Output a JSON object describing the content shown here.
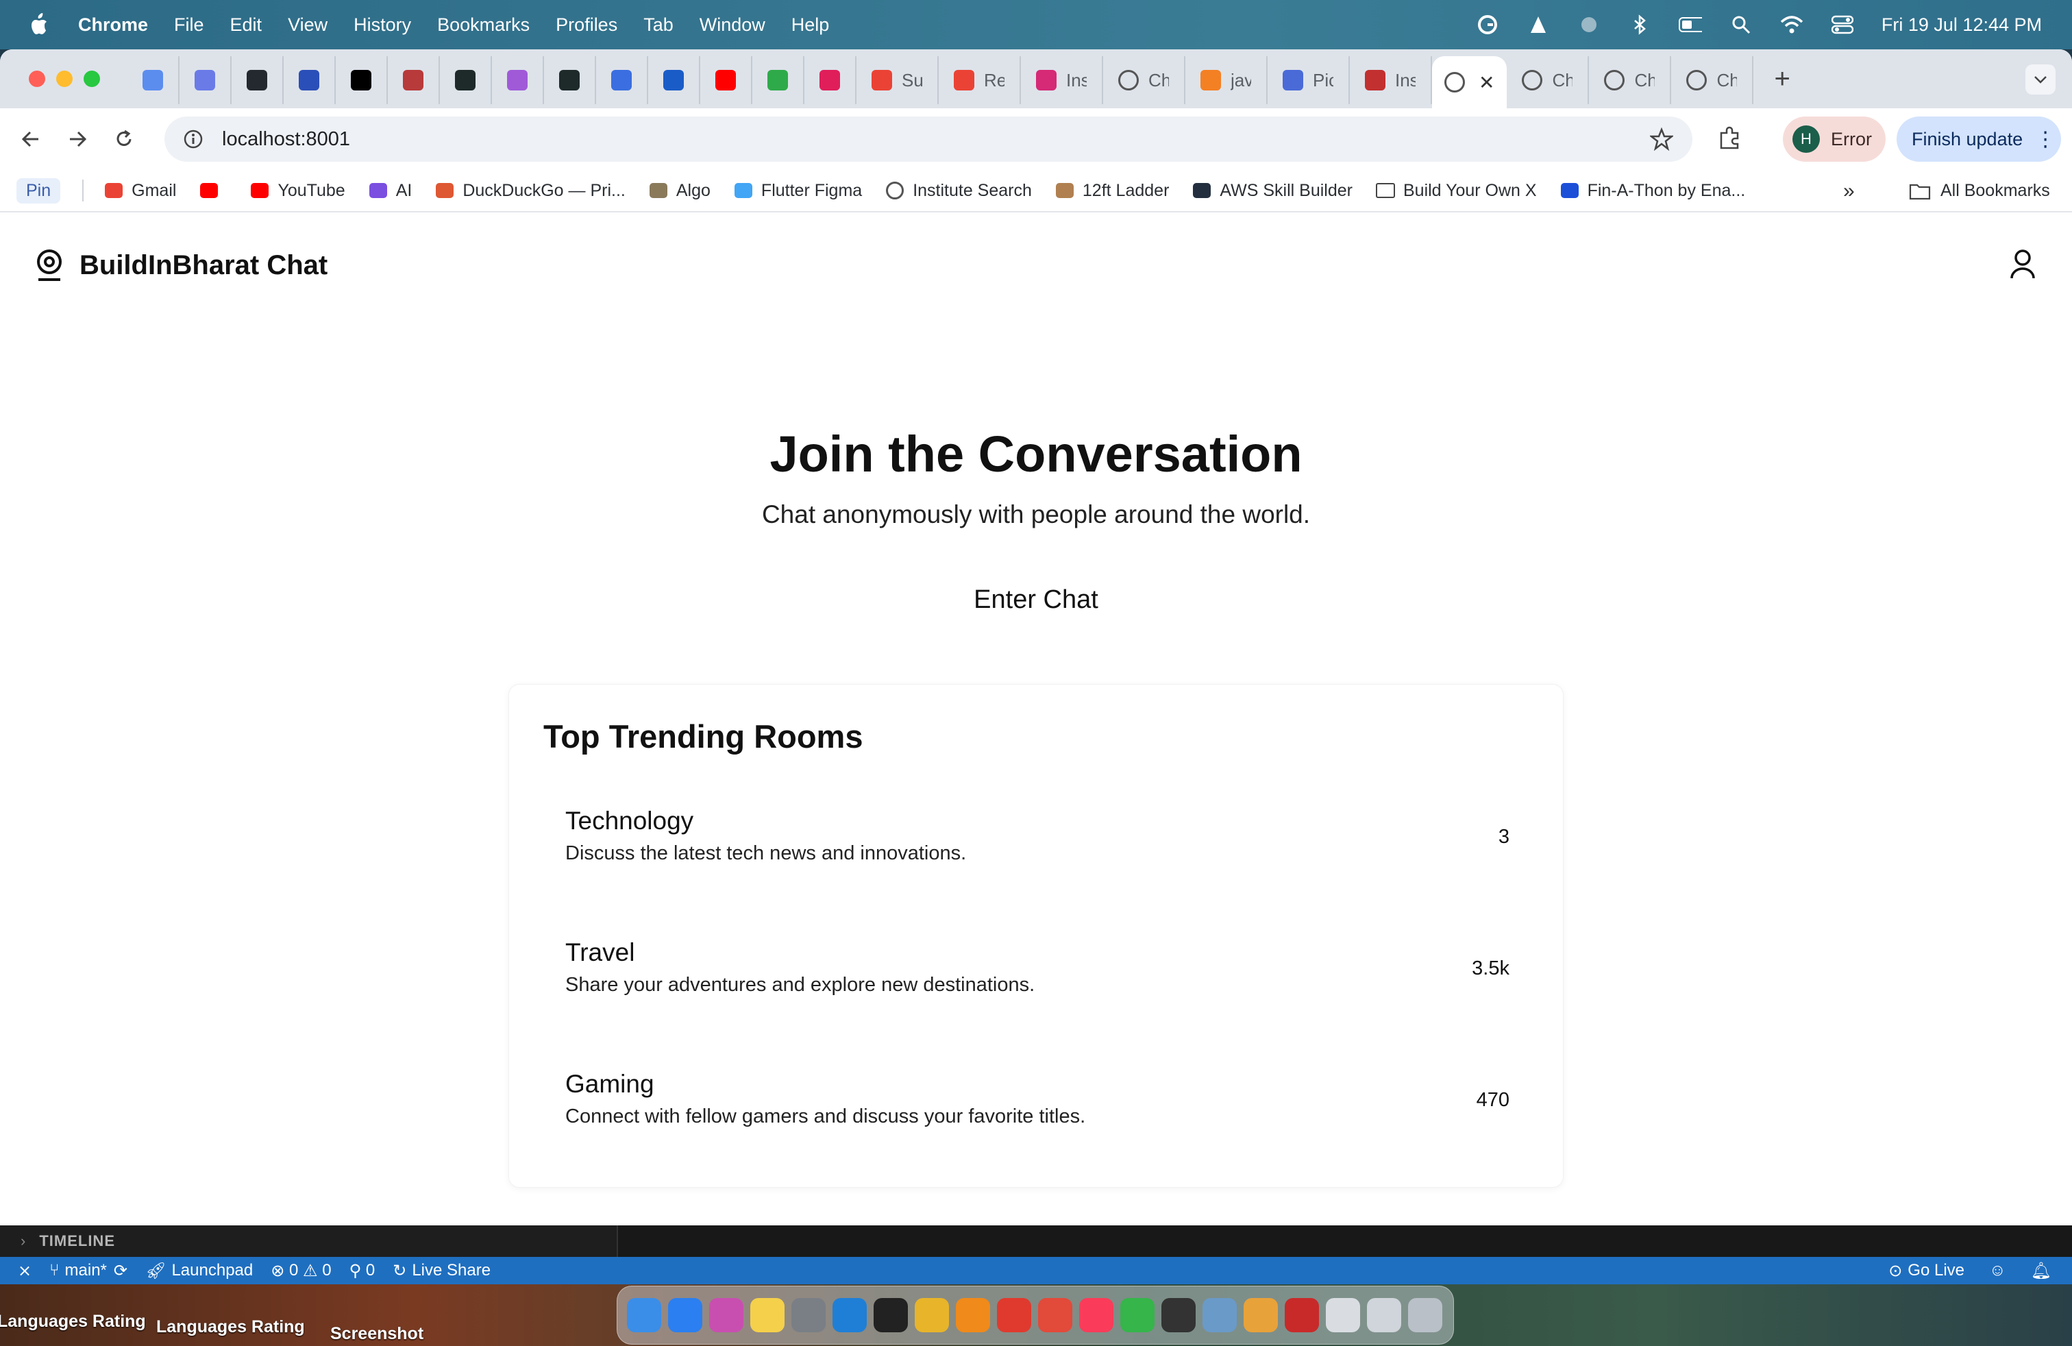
{
  "menubar": {
    "app": "Chrome",
    "items": [
      "File",
      "Edit",
      "View",
      "History",
      "Bookmarks",
      "Profiles",
      "Tab",
      "Window",
      "Help"
    ],
    "datetime": "Fri 19 Jul  12:44 PM"
  },
  "tabs": [
    {
      "title": "",
      "icon": "gemini-icon",
      "color": "#5b8def"
    },
    {
      "title": "",
      "icon": "magnet-icon",
      "color": "#6a7be8"
    },
    {
      "title": "",
      "icon": "github-icon",
      "color": "#24292f"
    },
    {
      "title": "",
      "icon": "half-moon-icon",
      "color": "#2b4fb8"
    },
    {
      "title": "",
      "icon": "medium-icon",
      "color": "#000000"
    },
    {
      "title": "",
      "icon": "bug-icon",
      "color": "#b83a3a"
    },
    {
      "title": "",
      "icon": "gc-icon",
      "color": "#1e2a2a"
    },
    {
      "title": "",
      "icon": "gradient-icon",
      "color": "#a05ad8"
    },
    {
      "title": "",
      "icon": "gc-icon",
      "color": "#1e2a2a"
    },
    {
      "title": "",
      "icon": "translate-icon",
      "color": "#3b6ee0"
    },
    {
      "title": "",
      "icon": "arc-icon",
      "color": "#1a5cc7"
    },
    {
      "title": "",
      "icon": "youtube-icon",
      "color": "#ff0000"
    },
    {
      "title": "",
      "icon": "green-badge-icon",
      "color": "#2faa4a"
    },
    {
      "title": "",
      "icon": "slack-icon",
      "color": "#e01e5a"
    },
    {
      "title": "Su",
      "icon": "gmail-icon",
      "color": "#ea4335"
    },
    {
      "title": "Re",
      "icon": "gmail-icon",
      "color": "#ea4335"
    },
    {
      "title": "Ins",
      "icon": "instagram-icon",
      "color": "#d62976"
    },
    {
      "title": "Ch",
      "icon": "globe-icon",
      "color": "#555555"
    },
    {
      "title": "jav",
      "icon": "stackoverflow-icon",
      "color": "#f48024"
    },
    {
      "title": "Pic",
      "icon": "cloud-icon",
      "color": "#4a6ad8"
    },
    {
      "title": "Ins",
      "icon": "cube-icon",
      "color": "#c23030"
    }
  ],
  "active_tab": {
    "icon": "globe-icon"
  },
  "trailing_tabs": [
    {
      "title": "Ch",
      "icon": "globe-icon"
    },
    {
      "title": "Ch",
      "icon": "globe-icon"
    },
    {
      "title": "Ch",
      "icon": "globe-icon"
    }
  ],
  "toolbar": {
    "url": "localhost:8001",
    "profile_initial": "H",
    "profile_label": "Error",
    "update_label": "Finish update"
  },
  "bookmarks": {
    "pin": "Pin",
    "items": [
      {
        "label": "Gmail",
        "icon": "gmail-icon"
      },
      {
        "label": "",
        "icon": "youtube-icon"
      },
      {
        "label": "YouTube",
        "icon": "youtube-icon"
      },
      {
        "label": "AI",
        "icon": "ai-v-icon"
      },
      {
        "label": "DuckDuckGo — Pri...",
        "icon": "duckduckgo-icon"
      },
      {
        "label": "Algo",
        "icon": "algo-icon"
      },
      {
        "label": "Flutter Figma",
        "icon": "flutter-icon"
      },
      {
        "label": "Institute Search",
        "icon": "globe-icon"
      },
      {
        "label": "12ft Ladder",
        "icon": "ladder-icon"
      },
      {
        "label": "AWS Skill Builder",
        "icon": "aws-icon"
      },
      {
        "label": "Build Your Own X",
        "icon": "folder-icon"
      },
      {
        "label": "Fin-A-Thon by Ena...",
        "icon": "unstop-icon"
      }
    ],
    "all": "All Bookmarks"
  },
  "page": {
    "brand": "BuildInBharat Chat",
    "hero_title": "Join the Conversation",
    "hero_subtitle": "Chat anonymously with people around the world.",
    "enter_button": "Enter Chat",
    "trending_title": "Top Trending Rooms",
    "rooms": [
      {
        "name": "Technology",
        "description": "Discuss the latest tech news and innovations.",
        "count": "3"
      },
      {
        "name": "Travel",
        "description": "Share your adventures and explore new destinations.",
        "count": "3.5k"
      },
      {
        "name": "Gaming",
        "description": "Connect with fellow gamers and discuss your favorite titles.",
        "count": "470"
      }
    ]
  },
  "vscode": {
    "timeline": "TIMELINE",
    "branch": "main*",
    "launchpad": "Launchpad",
    "errors": "0",
    "warnings": "0",
    "ports": "0",
    "live_share": "Live Share",
    "go_live": "Go Live"
  },
  "desktop_files": [
    "Languages Rating",
    "Languages Rating",
    "Screenshot"
  ]
}
